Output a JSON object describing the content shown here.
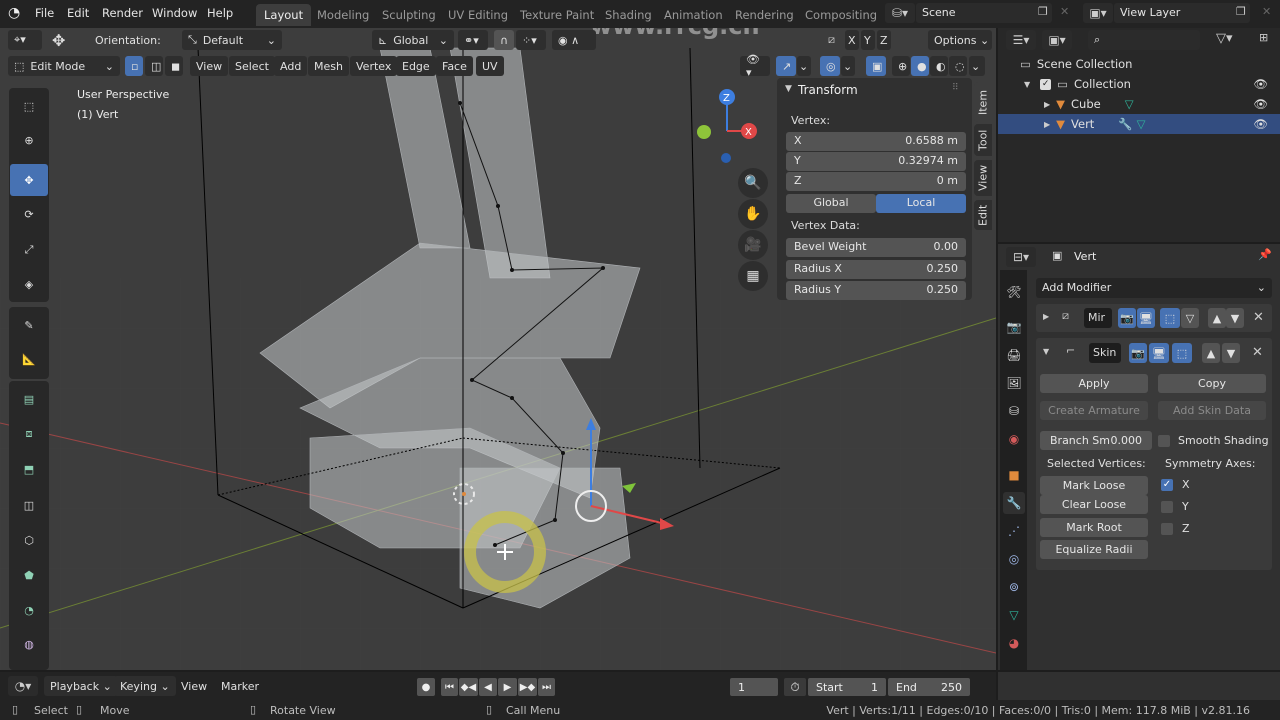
{
  "topbar": {
    "menus": [
      "File",
      "Edit",
      "Render",
      "Window",
      "Help"
    ],
    "workspaces": [
      "Layout",
      "Modeling",
      "Sculpting",
      "UV Editing",
      "Texture Paint",
      "Shading",
      "Animation",
      "Rendering",
      "Compositing"
    ],
    "active_workspace": "Layout",
    "scene": "Scene",
    "view_layer": "View Layer"
  },
  "viewport_header": {
    "orientation_label": "Orientation:",
    "orientation_value": "Default",
    "transform_orientation": "Global",
    "axes": [
      "X",
      "Y",
      "Z"
    ],
    "options_label": "Options",
    "mode": "Edit Mode",
    "menus": [
      "View",
      "Select",
      "Add",
      "Mesh",
      "Vertex",
      "Edge",
      "Face",
      "UV"
    ]
  },
  "viewport": {
    "view_name": "User Perspective",
    "object_label": "(1) Vert",
    "gizmo_axes": [
      "Z",
      "X"
    ]
  },
  "sidebar_tabs": [
    "Item",
    "Tool",
    "View",
    "Edit"
  ],
  "transform_panel": {
    "title": "Transform",
    "vertex_label": "Vertex:",
    "x_label": "X",
    "x_value": "0.6588 m",
    "y_label": "Y",
    "y_value": "0.32974 m",
    "z_label": "Z",
    "z_value": "0 m",
    "space_options": [
      "Global",
      "Local"
    ],
    "active_space": "Local",
    "vertex_data_label": "Vertex Data:",
    "bevel_weight_label": "Bevel Weight",
    "bevel_weight_value": "0.00",
    "radius_x_label": "Radius X",
    "radius_x_value": "0.250",
    "radius_y_label": "Radius Y",
    "radius_y_value": "0.250"
  },
  "outliner": {
    "search_placeholder": "",
    "items": [
      {
        "label": "Scene Collection"
      },
      {
        "label": "Collection"
      },
      {
        "label": "Cube"
      },
      {
        "label": "Vert",
        "selected": true
      }
    ]
  },
  "properties": {
    "object_name": "Vert",
    "add_modifier_label": "Add Modifier",
    "modifiers": [
      {
        "name": "Mir",
        "collapsed": true
      },
      {
        "name": "Skin",
        "collapsed": false
      }
    ],
    "skin": {
      "apply_label": "Apply",
      "copy_label": "Copy",
      "create_armature_label": "Create Armature",
      "add_skin_data_label": "Add Skin Data",
      "branch_smooth_label": "Branch Sm",
      "branch_smooth_value": "0.000",
      "smooth_shading_label": "Smooth Shading",
      "smooth_shading_checked": false,
      "selected_vertices_label": "Selected Vertices:",
      "mark_loose_label": "Mark Loose",
      "clear_loose_label": "Clear Loose",
      "mark_root_label": "Mark Root",
      "equalize_radii_label": "Equalize Radii",
      "symmetry_axes_label": "Symmetry Axes:",
      "sym_x_label": "X",
      "sym_x": true,
      "sym_y_label": "Y",
      "sym_y": false,
      "sym_z_label": "Z",
      "sym_z": false
    }
  },
  "timeline": {
    "menus": [
      "Playback",
      "Keying",
      "View",
      "Marker"
    ],
    "current_frame": "1",
    "start_label": "Start",
    "start_value": "1",
    "end_label": "End",
    "end_value": "250"
  },
  "statusbar": {
    "select_label": "Select",
    "move_label": "Move",
    "rotate_label": "Rotate View",
    "call_menu_label": "Call Menu",
    "stats": "Vert | Verts:1/11 | Edges:0/10 | Faces:0/0 | Tris:0 | Mem: 117.8 MiB | v2.81.16"
  },
  "watermark": "www.rrcg.cn",
  "colors": {
    "accent": "#4772b3",
    "object_orange": "#e08a3c",
    "mesh_green": "#2fb39a"
  }
}
